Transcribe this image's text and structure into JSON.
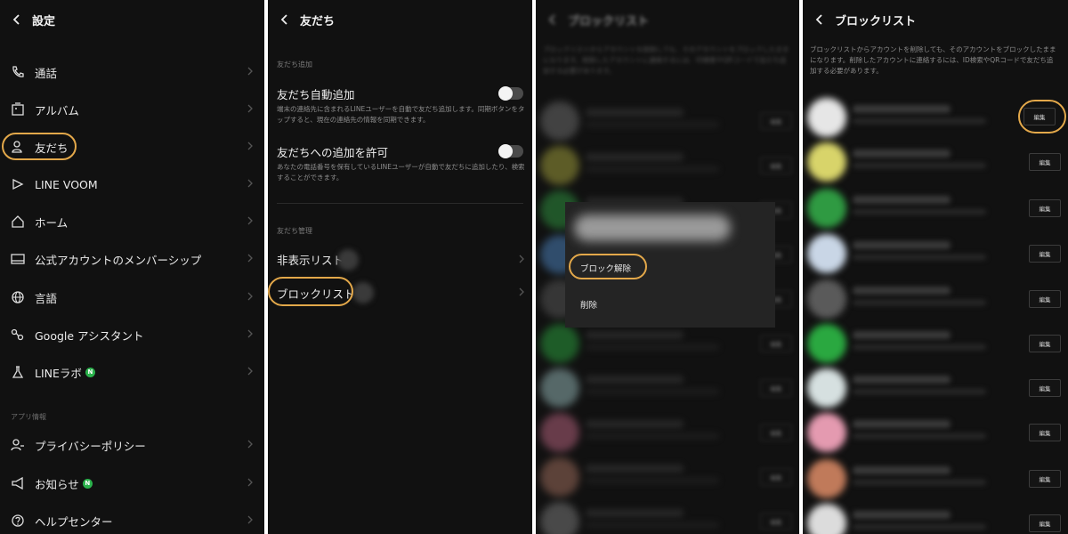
{
  "panel1": {
    "header": {
      "title": "設定"
    },
    "items": [
      {
        "label": "通話",
        "icon": "phone-icon"
      },
      {
        "label": "アルバム",
        "icon": "album-icon"
      },
      {
        "label": "友だち",
        "icon": "friends-icon"
      },
      {
        "label": "LINE VOOM",
        "icon": "voom-icon"
      },
      {
        "label": "ホーム",
        "icon": "home-icon"
      },
      {
        "label": "公式アカウントのメンバーシップ",
        "icon": "membership-card-icon"
      },
      {
        "label": "言語",
        "icon": "globe-icon"
      },
      {
        "label": "Google アシスタント",
        "icon": "assistant-icon"
      },
      {
        "label": "LINEラボ",
        "icon": "flask-icon",
        "badge": "N"
      }
    ],
    "section_app": "アプリ情報",
    "items2": [
      {
        "label": "プライバシーポリシー",
        "icon": "privacy-icon"
      },
      {
        "label": "お知らせ",
        "icon": "megaphone-icon",
        "badge": "N"
      },
      {
        "label": "ヘルプセンター",
        "icon": "help-icon"
      }
    ]
  },
  "panel2": {
    "header": {
      "title": "友だち"
    },
    "section_add": "友だち追加",
    "auto_add": {
      "title": "友だち自動追加",
      "desc": "端末の連絡先に含まれるLINEユーザーを自動で友だち追加します。同期ボタンをタップすると、現在の連絡先の情報を同期できます。"
    },
    "allow_add": {
      "title": "友だちへの追加を許可",
      "desc": "あなたの電話番号を保有しているLINEユーザーが自動で友だちに追加したり、検索することができます。"
    },
    "section_manage": "友だち管理",
    "hidden_list": "非表示リスト",
    "block_list": "ブロックリスト"
  },
  "panel3": {
    "header": {
      "title": "ブロックリスト"
    },
    "desc": "ブロックリストからアカウントを削除しても、そのアカウントをブロックしたままになります。削除したアカウントに連絡するには、ID検索やQRコードで友だち追加する必要があります。",
    "edit_label": "編集",
    "popup": {
      "unblock": "ブロック解除",
      "delete": "削除"
    }
  },
  "panel4": {
    "header": {
      "title": "ブロックリスト"
    },
    "desc": "ブロックリストからアカウントを削除しても、そのアカウントをブロックしたままになります。削除したアカウントに連絡するには、ID検索やQRコードで友だち追加する必要があります。",
    "edit_label": "編集"
  },
  "colors": {
    "background": "#111111",
    "highlight": "#e3a84a",
    "badge_green": "#2bb24c",
    "avatars": [
      "#6a6a6a",
      "#9c9a3a",
      "#2e8f3e",
      "#4a7fb8",
      "#555555",
      "#2a9a3c",
      "#8fb0b0",
      "#b0607a",
      "#9a6a5a",
      "#777777"
    ]
  }
}
